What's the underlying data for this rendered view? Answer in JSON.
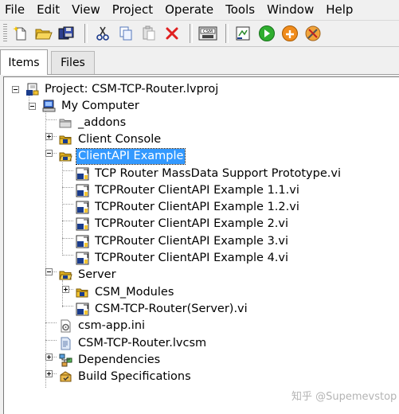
{
  "menu": [
    "File",
    "Edit",
    "View",
    "Project",
    "Operate",
    "Tools",
    "Window",
    "Help"
  ],
  "toolbar": {
    "buttons": [
      {
        "name": "new-icon"
      },
      {
        "name": "open-folder-icon"
      },
      {
        "name": "save-all-icon"
      },
      {
        "name": "cut-icon"
      },
      {
        "name": "copy-icon"
      },
      {
        "name": "paste-icon"
      },
      {
        "name": "delete-icon"
      },
      {
        "name": "csm-icon"
      },
      {
        "name": "vi-icon"
      },
      {
        "name": "run-icon"
      },
      {
        "name": "build-icon"
      },
      {
        "name": "tools-icon"
      }
    ]
  },
  "tabs": {
    "items": "Items",
    "files": "Files",
    "active": "Items"
  },
  "tree": {
    "project": "Project: CSM-TCP-Router.lvproj",
    "my_computer": "My Computer",
    "addons": "_addons",
    "client_console": "Client Console",
    "clientapi_example": "ClientAPI Example",
    "clientapi_items": [
      "TCP Router MassData Support Prototype.vi",
      "TCPRouter ClientAPI Example 1.1.vi",
      "TCPRouter ClientAPI Example 1.2.vi",
      "TCPRouter ClientAPI Example 2.vi",
      "TCPRouter ClientAPI Example 3.vi",
      "TCPRouter ClientAPI Example 4.vi"
    ],
    "server": "Server",
    "csm_modules": "CSM_Modules",
    "server_vi": "CSM-TCP-Router(Server).vi",
    "csm_app_ini": "csm-app.ini",
    "lvcsm": "CSM-TCP-Router.lvcsm",
    "dependencies": "Dependencies",
    "build_specs": "Build Specifications",
    "selected": "ClientAPI Example"
  },
  "watermark": "知乎 @Supemevstop",
  "colors": {
    "selection": "#3399ff",
    "folder_yellow": "#f4c430",
    "vi_blue": "#1a3c8c"
  }
}
